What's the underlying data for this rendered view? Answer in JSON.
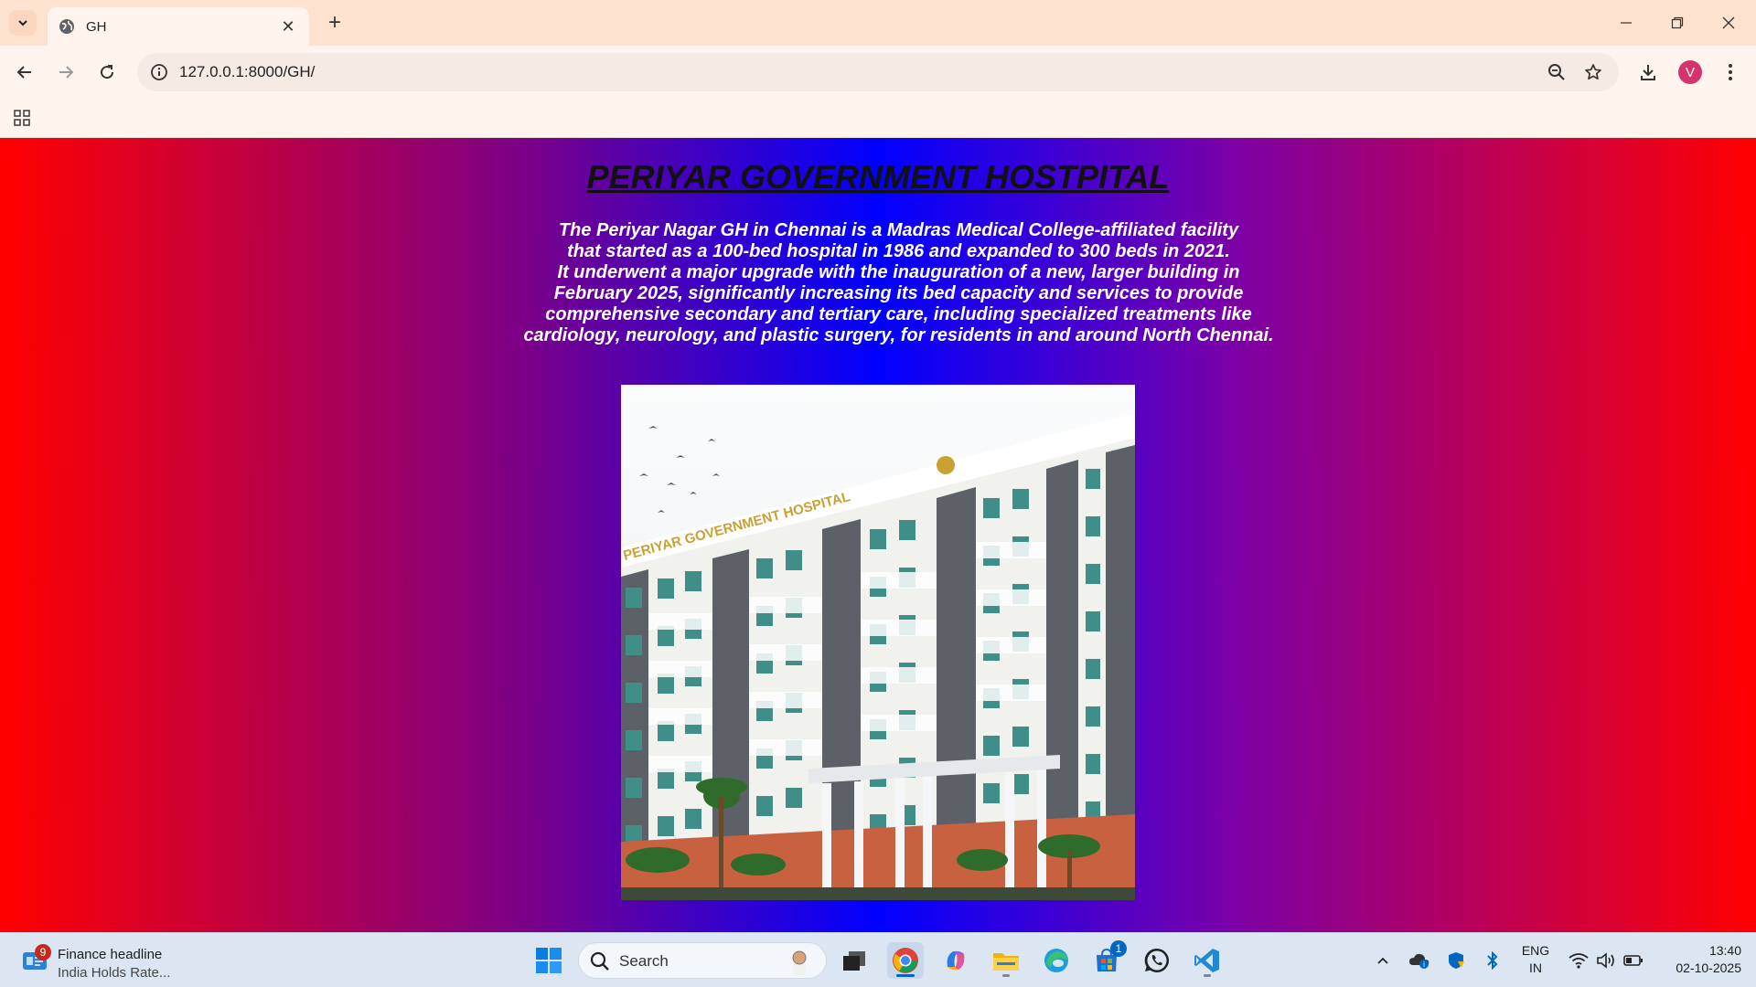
{
  "browser": {
    "tab": {
      "title": "GH"
    },
    "address": {
      "url": "127.0.0.1:8000/GH/"
    },
    "profile_initial": "V"
  },
  "page": {
    "heading": "PERIYAR GOVERNMENT HOSTPITAL",
    "paragraph_lines": [
      "The Periyar Nagar GH in Chennai is a Madras Medical College-affiliated facility",
      "that started as a 100-bed hospital in 1986 and expanded to 300 beds in 2021.",
      "It underwent a major upgrade with the inauguration of a new, larger building in",
      "February 2025, significantly increasing its bed capacity and services to provide",
      "comprehensive secondary and tertiary care, including specialized treatments like",
      "cardiology, neurology, and plastic surgery, for residents in and around North Chennai."
    ],
    "image_signage": "PERIYAR GOVERNMENT HOSPITAL",
    "colors": {
      "gradient_edge": "#ff0000",
      "gradient_center": "#0000ff",
      "mid": "#7a0088"
    }
  },
  "taskbar": {
    "news": {
      "badge": "9",
      "title": "Finance headline",
      "subtitle": "India Holds Rate..."
    },
    "search_placeholder": "Search",
    "store_badge": "1",
    "tray": {
      "lang_line1": "ENG",
      "lang_line2": "IN"
    },
    "clock": {
      "time": "13:40",
      "date": "02-10-2025"
    }
  }
}
